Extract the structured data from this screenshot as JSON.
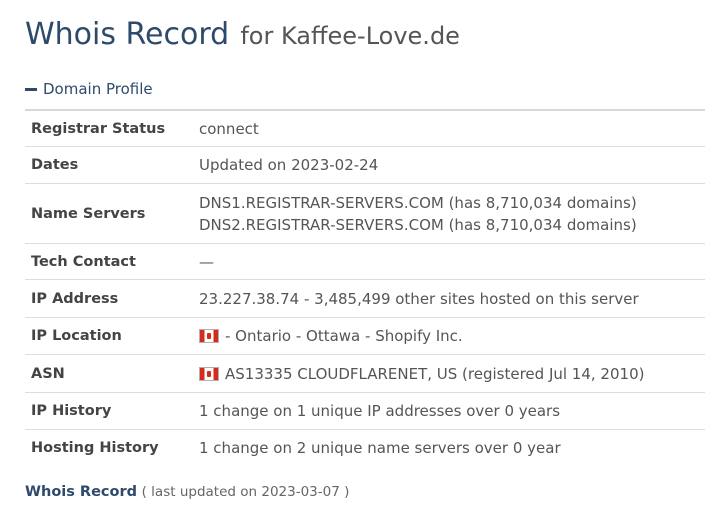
{
  "header": {
    "title": "Whois Record",
    "subtitle": "for Kaffee-Love.de"
  },
  "domain_profile": {
    "section_label": "Domain Profile",
    "rows": [
      {
        "label": "Registrar Status",
        "value": "connect"
      },
      {
        "label": "Dates",
        "value": "Updated on 2023-02-24"
      },
      {
        "label": "Name Servers",
        "values": [
          "DNS1.REGISTRAR-SERVERS.COM (has 8,710,034 domains)",
          "DNS2.REGISTRAR-SERVERS.COM (has 8,710,034 domains)"
        ]
      },
      {
        "label": "Tech Contact",
        "value": "—"
      },
      {
        "label": "IP Address",
        "value": "23.227.38.74 - 3,485,499 other sites hosted on this server"
      },
      {
        "label": "IP Location",
        "value": "- Ontario - Ottawa - Shopify Inc.",
        "flag": "canada-flag-icon"
      },
      {
        "label": "ASN",
        "value": "AS13335 CLOUDFLARENET, US (registered Jul 14, 2010)",
        "flag": "canada-flag-icon"
      },
      {
        "label": "IP History",
        "value": "1 change on 1 unique IP addresses over 0 years"
      },
      {
        "label": "Hosting History",
        "value": "1 change on 2 unique name servers over 0 year"
      }
    ]
  },
  "footer": {
    "link_label": "Whois Record",
    "note": "( last updated on 2023-03-07 )"
  },
  "colors": {
    "heading": "#2e4a6b",
    "text": "#555555",
    "border": "#dddddd"
  }
}
